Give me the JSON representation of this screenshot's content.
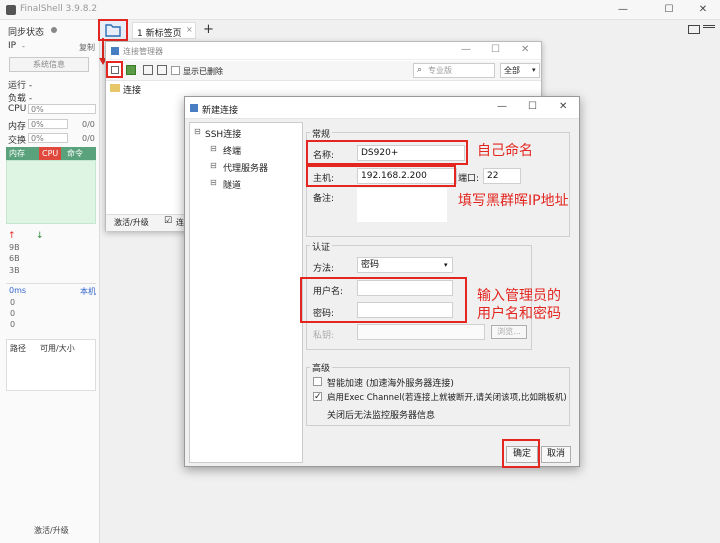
{
  "app": {
    "title": "FinalShell 3.9.8.2",
    "tab_label": "1 新标签页",
    "add_tab": "+"
  },
  "sidebar": {
    "sync_status": "同步状态",
    "ip_label": "IP",
    "ip_value": "-",
    "copy": "复制",
    "sys_info": "系统信息",
    "uptime": "运行 -",
    "load": "负载 -",
    "cpu_label": "CPU",
    "cpu_value": "0%",
    "mem_label": "内存",
    "mem_value": "0%",
    "mem_ratio": "0/0",
    "swap_label": "交换",
    "swap_value": "0%",
    "swap_ratio": "0/0",
    "proc_tabs": [
      "内存",
      "CPU",
      "命令"
    ],
    "net_values": [
      "9B",
      "6B",
      "3B"
    ],
    "ping_label": "0ms",
    "ping_host": "本机",
    "ping_values": [
      "0",
      "0",
      "0"
    ],
    "disk_cols": [
      "路径",
      "可用/大小"
    ],
    "footer": "激活/升级"
  },
  "conn_manager": {
    "title": "连接管理器",
    "show_deleted": "显示已删除",
    "search_placeholder": "专业版",
    "scope": "全部",
    "root_folder": "连接",
    "footer": "激活/升级",
    "footer_extra": "连"
  },
  "new_conn": {
    "title": "新建连接",
    "tree": {
      "root": "SSH连接",
      "children": [
        "终端",
        "代理服务器",
        "隧道"
      ]
    },
    "general": {
      "title": "常规",
      "name_label": "名称:",
      "name_value": "DS920+",
      "host_label": "主机:",
      "host_value": "192.168.2.200",
      "port_label": "端口:",
      "port_value": "22",
      "remark_label": "备注:"
    },
    "auth": {
      "title": "认证",
      "method_label": "方法:",
      "method_value": "密码",
      "user_label": "用户名:",
      "password_label": "密码:",
      "key_label": "私钥:",
      "browse": "浏览..."
    },
    "advanced": {
      "title": "高级",
      "smart_accel": "智能加速 (加速海外服务器连接)",
      "exec_channel": "启用Exec Channel(若连接上就被断开,请关闭该项,比如跳板机)",
      "no_monitor": "关闭后无法监控服务器信息",
      "smart_accel_checked": false,
      "exec_channel_checked": true
    },
    "ok": "确定",
    "cancel": "取消"
  },
  "annotations": {
    "name_note": "自己命名",
    "host_note": "填写黑群晖IP地址",
    "cred_note_1": "输入管理员的",
    "cred_note_2": "用户名和密码"
  },
  "colors": {
    "annotation_red": "#e32620",
    "mem_tab_green": "#5aa27c",
    "cpu_tab_red": "#e0483c",
    "mem_panel": "#dff5e4"
  }
}
